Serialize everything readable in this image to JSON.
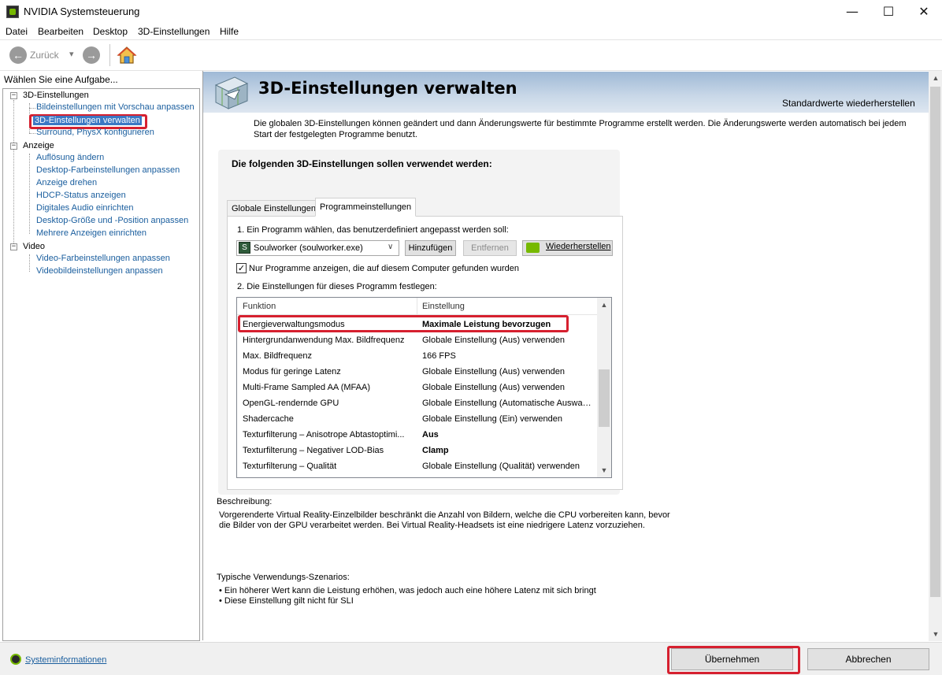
{
  "window": {
    "title": "NVIDIA Systemsteuerung",
    "minimize_glyph": "—",
    "maximize_glyph": "☐",
    "close_glyph": "✕"
  },
  "menu": [
    "Datei",
    "Bearbeiten",
    "Desktop",
    "3D-Einstellungen",
    "Hilfe"
  ],
  "toolbar": {
    "back_label": "Zurück",
    "back_glyph": "←",
    "forward_glyph": "→",
    "dropdown_glyph": "▾"
  },
  "sidebar": {
    "header": "Wählen Sie eine Aufgabe...",
    "categories": [
      {
        "label": "3D-Einstellungen",
        "toggle": "−",
        "items": [
          "Bildeinstellungen mit Vorschau anpassen",
          "3D-Einstellungen verwalten",
          "Surround, PhysX konfigurieren"
        ]
      },
      {
        "label": "Anzeige",
        "toggle": "−",
        "items": [
          "Auflösung ändern",
          "Desktop-Farbeinstellungen anpassen",
          "Anzeige drehen",
          "HDCP-Status anzeigen",
          "Digitales Audio einrichten",
          "Desktop-Größe und -Position anpassen",
          "Mehrere Anzeigen einrichten"
        ]
      },
      {
        "label": "Video",
        "toggle": "−",
        "items": [
          "Video-Farbeinstellungen anpassen",
          "Videobildeinstellungen anpassen"
        ]
      }
    ],
    "selected": "3D-Einstellungen verwalten"
  },
  "main": {
    "title": "3D-Einstellungen verwalten",
    "restore_defaults": "Standardwerte wiederherstellen",
    "intro": "Die globalen 3D-Einstellungen können geändert und dann Änderungswerte für bestimmte Programme erstellt werden. Die Änderungswerte werden automatisch bei jedem Start der festgelegten Programme benutzt.",
    "group_title": "Die folgenden 3D-Einstellungen sollen verwendet werden:",
    "tabs": [
      "Globale Einstellungen",
      "Programmeinstellungen"
    ],
    "active_tab": "Programmeinstellungen",
    "step1_label": "1. Ein Programm wählen, das benutzerdefiniert angepasst werden soll:",
    "program_selected": "Soulworker (soulworker.exe)",
    "btn_add": "Hinzufügen",
    "btn_remove": "Entfernen",
    "btn_restore": "Wiederherstellen",
    "checkbox_label": "Nur Programme anzeigen, die auf diesem Computer gefunden wurden",
    "checkbox_checked": true,
    "checkbox_glyph": "✓",
    "step2_label": "2. Die Einstellungen für dieses Programm festlegen:",
    "table": {
      "col_function": "Funktion",
      "col_setting": "Einstellung",
      "rows": [
        {
          "f": "Energieverwaltungsmodus",
          "v": "Maximale Leistung bevorzugen"
        },
        {
          "f": "Hintergrundanwendung Max. Bildfrequenz",
          "v": "Globale Einstellung (Aus) verwenden"
        },
        {
          "f": "Max. Bildfrequenz",
          "v": "166 FPS"
        },
        {
          "f": "Modus für geringe Latenz",
          "v": "Globale Einstellung (Aus) verwenden"
        },
        {
          "f": "Multi-Frame Sampled AA (MFAA)",
          "v": "Globale Einstellung (Aus) verwenden"
        },
        {
          "f": "OpenGL-rendernde GPU",
          "v": "Globale Einstellung (Automatische Auswahl..."
        },
        {
          "f": "Shadercache",
          "v": "Globale Einstellung (Ein) verwenden"
        },
        {
          "f": "Texturfilterung – Anisotrope Abtastoptimi...",
          "v": "Aus"
        },
        {
          "f": "Texturfilterung – Negativer LOD-Bias",
          "v": "Clamp"
        },
        {
          "f": "Texturfilterung – Qualität",
          "v": "Globale Einstellung (Qualität) verwenden"
        }
      ],
      "scroll_up_glyph": "▲",
      "scroll_down_glyph": "▼"
    },
    "description_label": "Beschreibung:",
    "description_text": "Vorgerenderte Virtual Reality-Einzelbilder beschränkt die Anzahl von Bildern, welche die CPU vorbereiten kann, bevor die Bilder von der GPU verarbeitet werden. Bei Virtual Reality-Headsets ist eine niedrigere Latenz vorzuziehen.",
    "usage_label": "Typische Verwendungs-Szenarios:",
    "usage_items": [
      "• Ein höherer Wert kann die Leistung erhöhen, was jedoch auch eine höhere Latenz mit sich bringt",
      "• Diese Einstellung gilt nicht für SLI"
    ]
  },
  "footer": {
    "sysinfo": "Systeminformationen",
    "apply": "Übernehmen",
    "cancel": "Abbrechen"
  },
  "colors": {
    "link": "#1a5e9e",
    "highlight_box": "#d6202f",
    "nvidia_green": "#76b900",
    "header_band": "#9fb9d6"
  }
}
